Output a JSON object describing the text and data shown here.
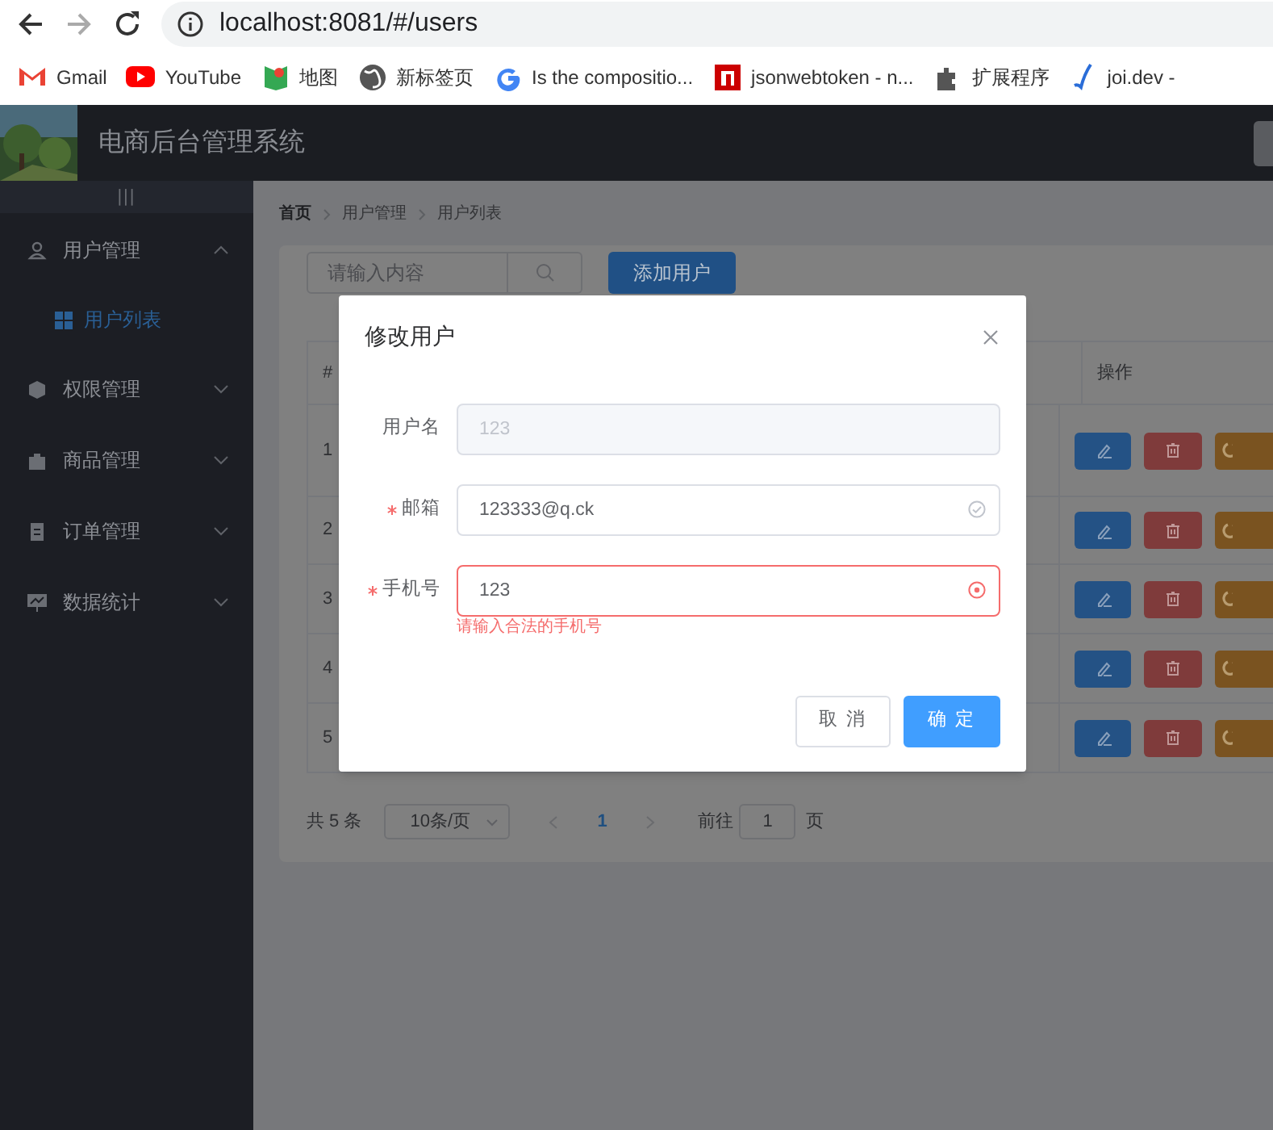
{
  "browser": {
    "address": "localhost:8081/#/users",
    "bookmarks": [
      {
        "label": "Gmail"
      },
      {
        "label": "YouTube"
      },
      {
        "label": "地图"
      },
      {
        "label": "新标签页"
      },
      {
        "label": "Is the compositio..."
      },
      {
        "label": "jsonwebtoken - n..."
      },
      {
        "label": "扩展程序"
      },
      {
        "label": "joi.dev - "
      }
    ]
  },
  "header": {
    "title": "电商后台管理系统"
  },
  "sidebar": {
    "toggle": "|||",
    "menus": [
      {
        "label": "用户管理",
        "expanded": true,
        "children": [
          {
            "label": "用户列表",
            "selected": true
          }
        ]
      },
      {
        "label": "权限管理",
        "expanded": false
      },
      {
        "label": "商品管理",
        "expanded": false
      },
      {
        "label": "订单管理",
        "expanded": false
      },
      {
        "label": "数据统计",
        "expanded": false
      }
    ]
  },
  "breadcrumb": [
    "首页",
    "用户管理",
    "用户列表"
  ],
  "toolbar": {
    "search_placeholder": "请输入内容",
    "add_button": "添加用户"
  },
  "table": {
    "columns": [
      "#",
      "操作"
    ],
    "rows": [
      "1",
      "2",
      "3",
      "4",
      "5"
    ]
  },
  "pagination": {
    "total": "共 5 条",
    "page_size": "10条/页",
    "pages": [
      {
        "label": "1",
        "selected": true
      }
    ],
    "goto_label": "前往",
    "goto_value": "1",
    "goto_suffix": "页"
  },
  "dialog": {
    "title": "修改用户",
    "fields": [
      {
        "label": "用户名",
        "value": "123",
        "required": false,
        "disabled": true
      },
      {
        "label": "邮箱",
        "value": "123333@q.ck",
        "required": true,
        "disabled": false,
        "valid": true
      },
      {
        "label": "手机号",
        "value": "123",
        "required": true,
        "disabled": false,
        "valid": false,
        "error": "请输入合法的手机号"
      }
    ],
    "buttons": [
      {
        "label": "取 消",
        "kind": "default"
      },
      {
        "label": "确 定",
        "kind": "primary"
      }
    ]
  }
}
